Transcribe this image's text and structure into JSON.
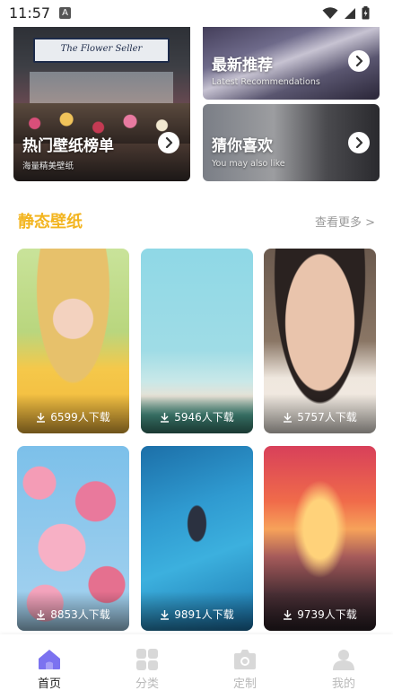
{
  "status": {
    "time": "11:57",
    "notif": "A"
  },
  "top_cards": {
    "hot": {
      "title": "热门壁纸榜单",
      "subtitle": "海量精美壁纸",
      "sign_text": "The Flower Seller"
    },
    "latest": {
      "title": "最新推荐",
      "subtitle": "Latest Recommendations"
    },
    "guess": {
      "title": "猜你喜欢",
      "subtitle": "You may also like"
    }
  },
  "section": {
    "title": "静态壁纸",
    "more": "查看更多 >"
  },
  "wallpapers": [
    {
      "downloads": "6599人下载"
    },
    {
      "downloads": "5946人下载"
    },
    {
      "downloads": "5757人下载"
    },
    {
      "downloads": "8853人下载"
    },
    {
      "downloads": "9891人下载"
    },
    {
      "downloads": "9739人下载"
    }
  ],
  "nav": [
    {
      "label": "首页",
      "icon": "home-icon",
      "active": true
    },
    {
      "label": "分类",
      "icon": "grid-icon",
      "active": false
    },
    {
      "label": "定制",
      "icon": "camera-icon",
      "active": false
    },
    {
      "label": "我的",
      "icon": "profile-icon",
      "active": false
    }
  ],
  "colors": {
    "accent": "#f3b520",
    "nav_active": "#7b72f0",
    "nav_inactive": "#d8d8d8"
  }
}
